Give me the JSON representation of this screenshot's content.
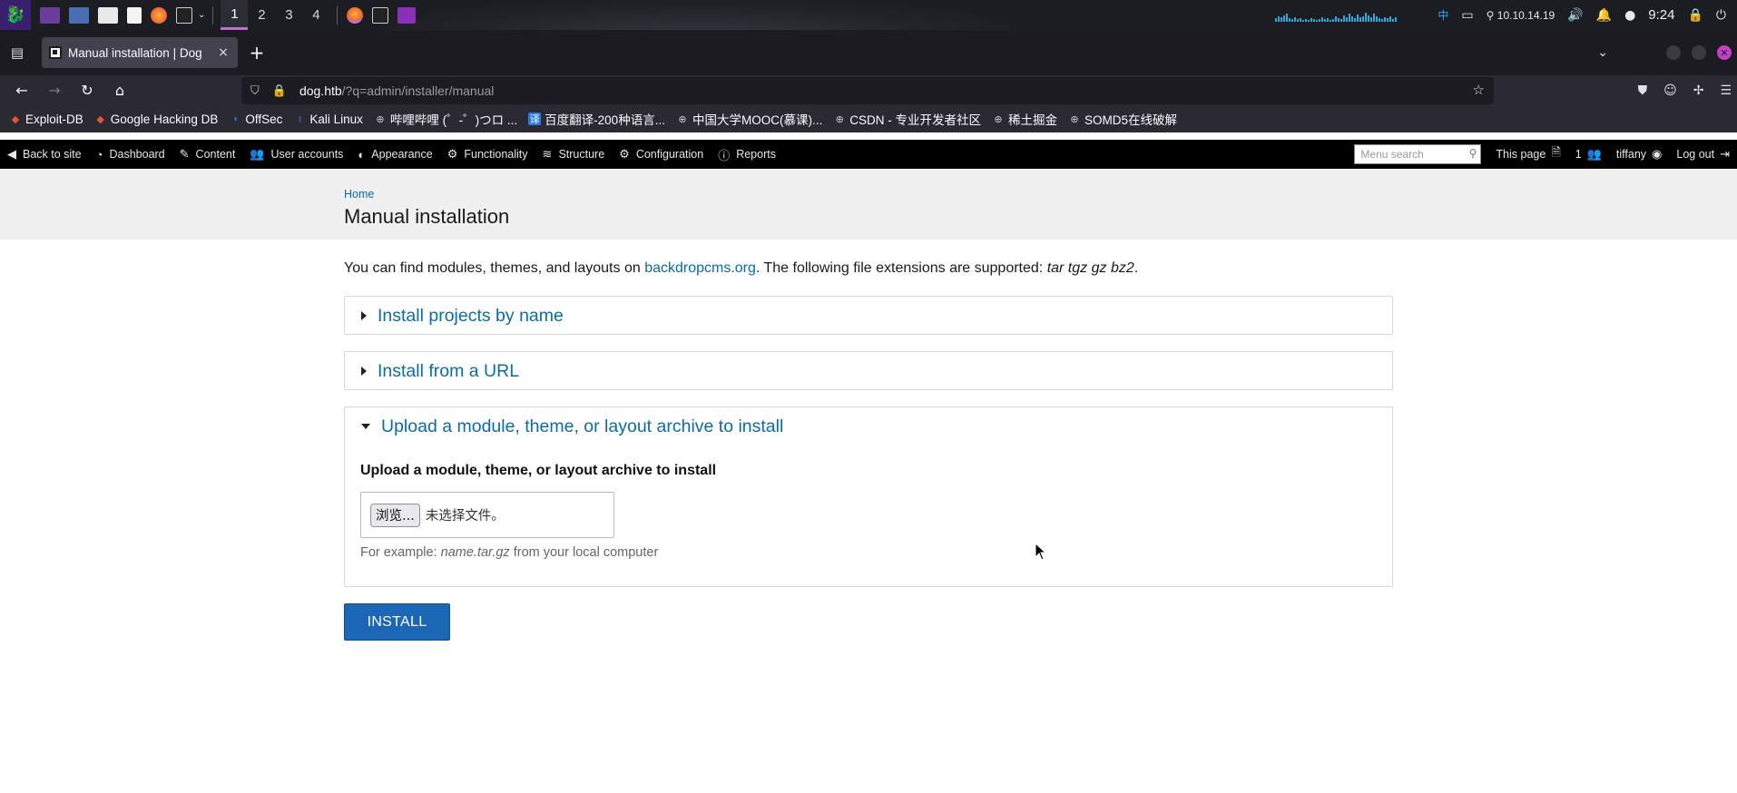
{
  "os_panel": {
    "workspaces": [
      "1",
      "2",
      "3",
      "4"
    ],
    "active_workspace": "1",
    "ime": "中",
    "ip": "10.10.14.19",
    "clock": "9:24"
  },
  "browser": {
    "tab": {
      "title": "Manual installation | Dog",
      "close": "×"
    },
    "new_tab": "+",
    "url": {
      "host": "dog.htb",
      "path": "/?q=admin/installer/manual"
    },
    "bookmarks": [
      {
        "label": "Exploit-DB",
        "color": "#e8542e"
      },
      {
        "label": "Google Hacking DB",
        "color": "#e8542e"
      },
      {
        "label": "OffSec",
        "color": "#2f6fd6"
      },
      {
        "label": "Kali Linux",
        "color": "#367bf0"
      },
      {
        "label": "哔哩哔哩 (゜-゜)つロ ...",
        "color": "#bbbbbb"
      },
      {
        "label": "百度翻译-200种语言...",
        "color": "#2a7ae2"
      },
      {
        "label": "中国大学MOOC(慕课)...",
        "color": "#bbbbbb"
      },
      {
        "label": "CSDN - 专业开发者社区",
        "color": "#bbbbbb"
      },
      {
        "label": "稀土掘金",
        "color": "#bbbbbb"
      },
      {
        "label": "SOMD5在线破解",
        "color": "#bbbbbb"
      }
    ]
  },
  "admin_bar": {
    "items": [
      {
        "label": "Back to site",
        "icon": "arrow-left-circle-icon",
        "glyph": "◀"
      },
      {
        "label": "Dashboard",
        "icon": "gauge-icon",
        "glyph": "◔"
      },
      {
        "label": "Content",
        "icon": "pencil-icon",
        "glyph": "✎"
      },
      {
        "label": "User accounts",
        "icon": "users-icon",
        "glyph": "👥"
      },
      {
        "label": "Appearance",
        "icon": "palette-icon",
        "glyph": "◐"
      },
      {
        "label": "Functionality",
        "icon": "plug-icon",
        "glyph": "⚙"
      },
      {
        "label": "Structure",
        "icon": "stack-icon",
        "glyph": "≋"
      },
      {
        "label": "Configuration",
        "icon": "gear-icon",
        "glyph": "⚙"
      },
      {
        "label": "Reports",
        "icon": "info-icon",
        "glyph": "ⓘ"
      }
    ],
    "menu_search_placeholder": "Menu search",
    "this_page": "This page",
    "user_count": "1",
    "username": "tiffany",
    "logout": "Log out"
  },
  "page": {
    "breadcrumb": "Home",
    "title": "Manual installation",
    "intro": {
      "before_link": "You can find modules, themes, and layouts on ",
      "link": "backdropcms.org",
      "after_link": ". The following file extensions are supported: ",
      "extensions": "tar tgz gz bz2",
      "end": "."
    },
    "fieldsets": [
      {
        "title": "Install projects by name",
        "expanded": false
      },
      {
        "title": "Install from a URL",
        "expanded": false
      },
      {
        "title": "Upload a module, theme, or layout archive to install",
        "expanded": true
      }
    ],
    "upload": {
      "label": "Upload a module, theme, or layout archive to install",
      "browse_button": "浏览...",
      "no_file": "未选择文件。",
      "desc_prefix": "For example: ",
      "desc_example": "name.tar.gz",
      "desc_suffix": " from your local computer"
    },
    "install_button": "INSTALL"
  }
}
